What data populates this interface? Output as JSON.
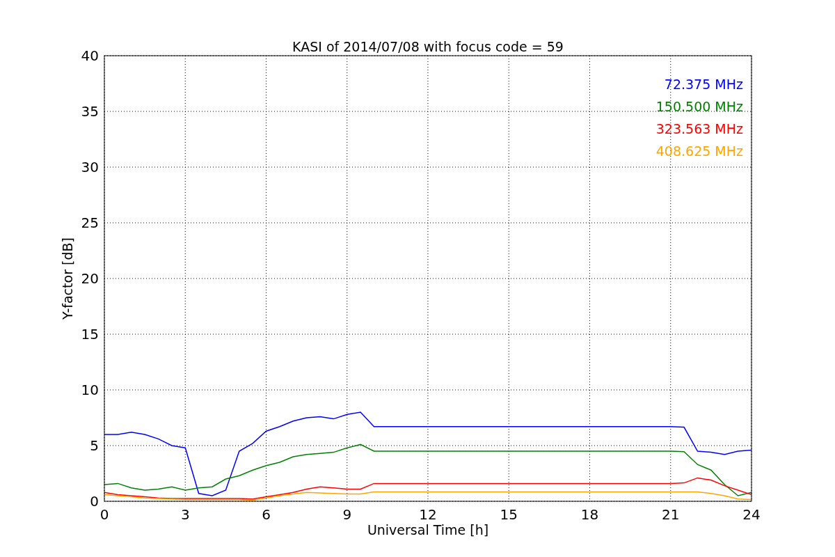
{
  "chart_data": {
    "type": "line",
    "title": "KASI of 2014/07/08 with focus code = 59",
    "xlabel": "Universal Time [h]",
    "ylabel": "Y-factor [dB]",
    "x": [
      0,
      0.5,
      1,
      1.5,
      2,
      2.5,
      3,
      3.5,
      4,
      4.5,
      5,
      5.5,
      6,
      6.5,
      7,
      7.5,
      8,
      8.5,
      9,
      9.5,
      10,
      10.5,
      11,
      11.5,
      12,
      12.5,
      13,
      13.5,
      14,
      14.5,
      15,
      15.5,
      16,
      16.5,
      17,
      17.5,
      18,
      18.5,
      19,
      19.5,
      20,
      20.5,
      21,
      21.5,
      22,
      22.5,
      23,
      23.5,
      24
    ],
    "series": [
      {
        "name": "72.375 MHz",
        "color": "#0000ff",
        "values": [
          6.0,
          6.0,
          6.2,
          6.0,
          5.6,
          5.0,
          4.8,
          0.7,
          0.5,
          1.0,
          4.5,
          5.2,
          6.3,
          6.7,
          7.2,
          7.5,
          7.6,
          7.4,
          7.8,
          8.0,
          6.7,
          6.7,
          6.7,
          6.7,
          6.7,
          6.7,
          6.7,
          6.7,
          6.7,
          6.7,
          6.7,
          6.7,
          6.7,
          6.7,
          6.7,
          6.7,
          6.7,
          6.7,
          6.7,
          6.7,
          6.7,
          6.7,
          6.7,
          6.65,
          4.5,
          4.4,
          4.2,
          4.5,
          4.6
        ]
      },
      {
        "name": "150.500 MHz",
        "color": "#008000",
        "values": [
          1.5,
          1.6,
          1.2,
          1.0,
          1.1,
          1.3,
          1.0,
          1.2,
          1.3,
          2.0,
          2.3,
          2.8,
          3.2,
          3.5,
          4.0,
          4.2,
          4.3,
          4.4,
          4.8,
          5.1,
          4.5,
          4.5,
          4.5,
          4.5,
          4.5,
          4.5,
          4.5,
          4.5,
          4.5,
          4.5,
          4.5,
          4.5,
          4.5,
          4.5,
          4.5,
          4.5,
          4.5,
          4.5,
          4.5,
          4.5,
          4.5,
          4.5,
          4.5,
          4.45,
          3.3,
          2.8,
          1.5,
          0.5,
          0.8
        ]
      },
      {
        "name": "323.563 MHz",
        "color": "#ff0000",
        "values": [
          0.8,
          0.6,
          0.5,
          0.4,
          0.3,
          0.25,
          0.25,
          0.25,
          0.25,
          0.25,
          0.25,
          0.2,
          0.4,
          0.6,
          0.8,
          1.1,
          1.3,
          1.2,
          1.1,
          1.1,
          1.6,
          1.6,
          1.6,
          1.6,
          1.6,
          1.6,
          1.6,
          1.6,
          1.6,
          1.6,
          1.6,
          1.6,
          1.6,
          1.6,
          1.6,
          1.6,
          1.6,
          1.6,
          1.6,
          1.6,
          1.6,
          1.6,
          1.6,
          1.65,
          2.1,
          1.9,
          1.4,
          1.0,
          0.6
        ]
      },
      {
        "name": "408.625 MHz",
        "color": "#ffa500",
        "values": [
          0.6,
          0.5,
          0.4,
          0.3,
          0.25,
          0.2,
          0.15,
          0.15,
          0.15,
          0.15,
          0.15,
          0.1,
          0.3,
          0.5,
          0.65,
          0.8,
          0.75,
          0.7,
          0.65,
          0.65,
          0.85,
          0.85,
          0.85,
          0.85,
          0.85,
          0.85,
          0.85,
          0.85,
          0.85,
          0.85,
          0.85,
          0.85,
          0.85,
          0.85,
          0.85,
          0.85,
          0.85,
          0.85,
          0.85,
          0.85,
          0.85,
          0.85,
          0.85,
          0.85,
          0.85,
          0.7,
          0.5,
          0.2,
          0.15
        ]
      }
    ],
    "grid": true,
    "xlim": [
      0,
      24
    ],
    "ylim": [
      0,
      40
    ],
    "xticks": [
      0,
      3,
      6,
      9,
      12,
      15,
      18,
      21,
      24
    ],
    "yticks": [
      0,
      5,
      10,
      15,
      20,
      25,
      30,
      35,
      40
    ]
  }
}
